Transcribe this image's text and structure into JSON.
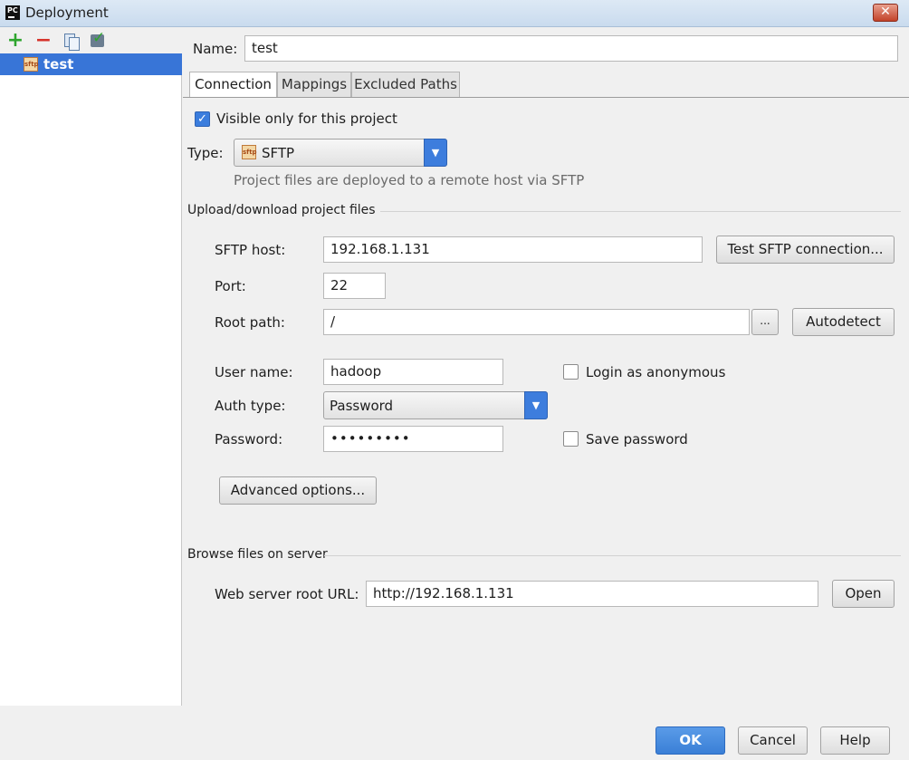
{
  "window": {
    "title": "Deployment",
    "app_badge": "PC",
    "close_glyph": "✕"
  },
  "toolbar": {
    "add_icon": "add-icon",
    "remove_icon": "remove-icon",
    "copy_icon": "copy-icon",
    "default_icon": "set-default-icon"
  },
  "tree": {
    "items": [
      {
        "label": "test",
        "badge": "sftp"
      }
    ]
  },
  "name": {
    "label": "Name:",
    "value": "test"
  },
  "tabs": [
    {
      "label": "Connection",
      "active": true
    },
    {
      "label": "Mappings",
      "active": false
    },
    {
      "label": "Excluded Paths",
      "active": false
    }
  ],
  "connection": {
    "visible_only_label": "Visible only for this project",
    "visible_only_checked": true,
    "type_label": "Type:",
    "type_value": "SFTP",
    "type_badge": "sftp",
    "type_hint": "Project files are deployed to a remote host via SFTP",
    "upload_section": "Upload/download project files",
    "sftp_host_label": "SFTP host:",
    "sftp_host_value": "192.168.1.131",
    "test_button": "Test SFTP connection...",
    "port_label": "Port:",
    "port_value": "22",
    "root_path_label": "Root path:",
    "root_path_value": "/",
    "browse_button": "...",
    "autodetect_button": "Autodetect",
    "user_name_label": "User name:",
    "user_name_value": "hadoop",
    "login_anonymous_label": "Login as anonymous",
    "login_anonymous_checked": false,
    "auth_type_label": "Auth type:",
    "auth_type_value": "Password",
    "password_label": "Password:",
    "password_value": "•••••••••",
    "save_password_label": "Save password",
    "save_password_checked": false,
    "advanced_button": "Advanced options...",
    "browse_section": "Browse files on server",
    "web_root_label": "Web server root URL:",
    "web_root_value": "http://192.168.1.131",
    "open_button": "Open"
  },
  "footer": {
    "ok": "OK",
    "cancel": "Cancel",
    "help": "Help"
  },
  "colors": {
    "accent": "#3875d7",
    "primary_button": "#3a7fd6"
  }
}
